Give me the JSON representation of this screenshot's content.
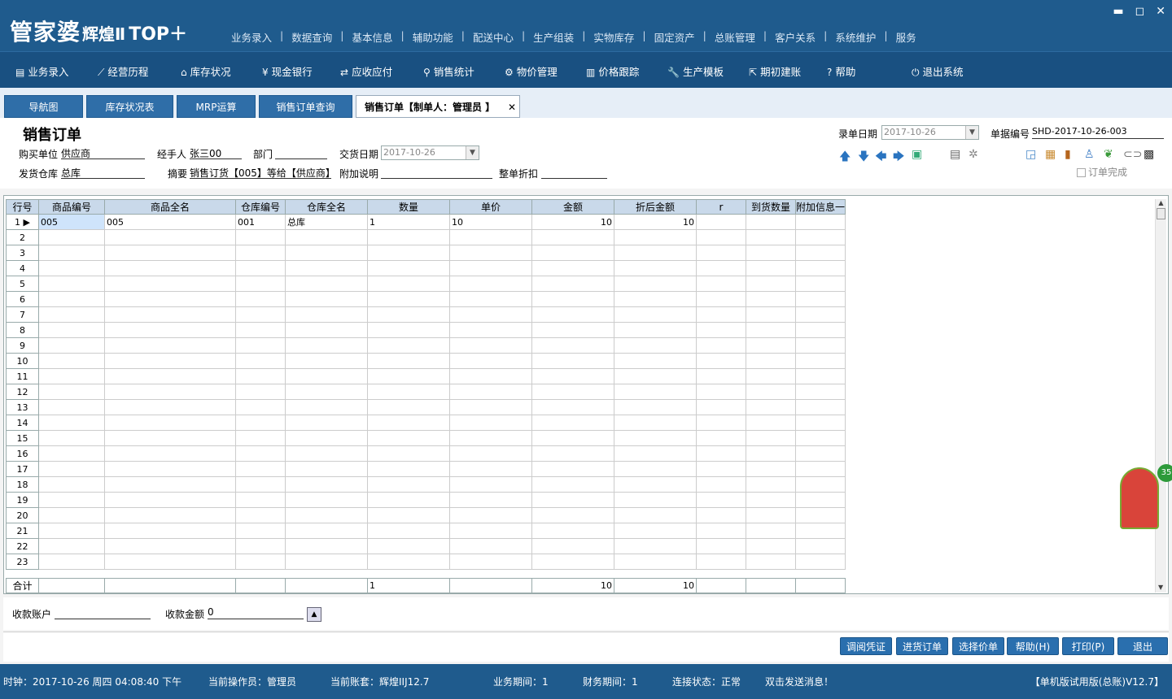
{
  "app": {
    "logo_main": "管家婆",
    "logo_sub": "辉煌Ⅱ",
    "logo_top": "TOP＋"
  },
  "top_menu": [
    "业务录入",
    "数据查询",
    "基本信息",
    "辅助功能",
    "配送中心",
    "生产组装",
    "实物库存",
    "固定资产",
    "总账管理",
    "客户关系",
    "系统维护",
    "服务"
  ],
  "toolbar": [
    {
      "label": "业务录入",
      "icon": "register-icon"
    },
    {
      "label": "经营历程",
      "icon": "trend-icon"
    },
    {
      "label": "库存状况",
      "icon": "home-icon"
    },
    {
      "label": "现金银行",
      "icon": "yen-icon"
    },
    {
      "label": "应收应付",
      "icon": "exchange-icon"
    },
    {
      "label": "销售统计",
      "icon": "search-icon"
    },
    {
      "label": "物价管理",
      "icon": "gear-icon"
    },
    {
      "label": "价格跟踪",
      "icon": "bar-chart-icon"
    },
    {
      "label": "生产模板",
      "icon": "wrench-icon"
    },
    {
      "label": "期初建账",
      "icon": "export-icon"
    },
    {
      "label": "帮助",
      "icon": "help-icon"
    },
    {
      "label": "退出系统",
      "icon": "power-icon"
    }
  ],
  "tabs": [
    "导航图",
    "库存状况表",
    "MRP运算",
    "销售订单查询",
    "销售订单【制单人：管理员 】"
  ],
  "form": {
    "title": "销售订单",
    "entry_date_label": "录单日期",
    "entry_date": "2017-10-26",
    "doc_no_label": "单据编号",
    "doc_no": "SHD-2017-10-26-003",
    "buyer_label": "购买单位",
    "buyer": "供应商",
    "handler_label": "经手人",
    "handler": "张三00",
    "dept_label": "部门",
    "dept": "",
    "delivery_date_label": "交货日期",
    "delivery_date": "2017-10-26",
    "warehouse_label": "发货仓库",
    "warehouse": "总库",
    "summary_label": "摘要",
    "summary": "销售订货【005】等给【供应商】",
    "note_label": "附加说明",
    "note": "",
    "discount_label": "整单折扣",
    "discount": "",
    "complete_label": "订单完成"
  },
  "grid": {
    "headers": [
      "行号",
      "商品编号",
      "商品全名",
      "仓库编号",
      "仓库全名",
      "数量",
      "单价",
      "金额",
      "折后金额",
      "r",
      "到货数量",
      "附加信息一"
    ],
    "row1": {
      "num": "1",
      "code": "005",
      "name": "005",
      "wh_code": "001",
      "wh_name": "总库",
      "qty": "1",
      "price": "10",
      "amount": "10",
      "disc_amount": "10"
    },
    "row_numbers": [
      "2",
      "3",
      "4",
      "5",
      "6",
      "7",
      "8",
      "9",
      "10",
      "11",
      "12",
      "13",
      "14",
      "15",
      "16",
      "17",
      "18",
      "19",
      "20",
      "21",
      "22",
      "23"
    ],
    "sum": {
      "label": "合计",
      "qty": "1",
      "amount": "10",
      "disc_amount": "10"
    }
  },
  "bottom": {
    "account_label": "收款账户",
    "account": "",
    "amount_label": "收款金额",
    "amount": "0"
  },
  "buttons": [
    "调阅凭证",
    "进货订单",
    "选择价单",
    "帮助(H)",
    "打印(P)",
    "退出"
  ],
  "status": {
    "clock": "时钟：2017-10-26 周四 04:08:40 下午",
    "operator": "当前操作员：管理员",
    "account_set": "当前账套：辉煌IIJ12.7",
    "biz_period": "业务期间：1",
    "fin_period": "财务期间：1",
    "conn": "连接状态：正常",
    "msg": "双击发送消息！",
    "version": "【单机版试用版(总账)V12.7】"
  },
  "mascot_badge": "35"
}
